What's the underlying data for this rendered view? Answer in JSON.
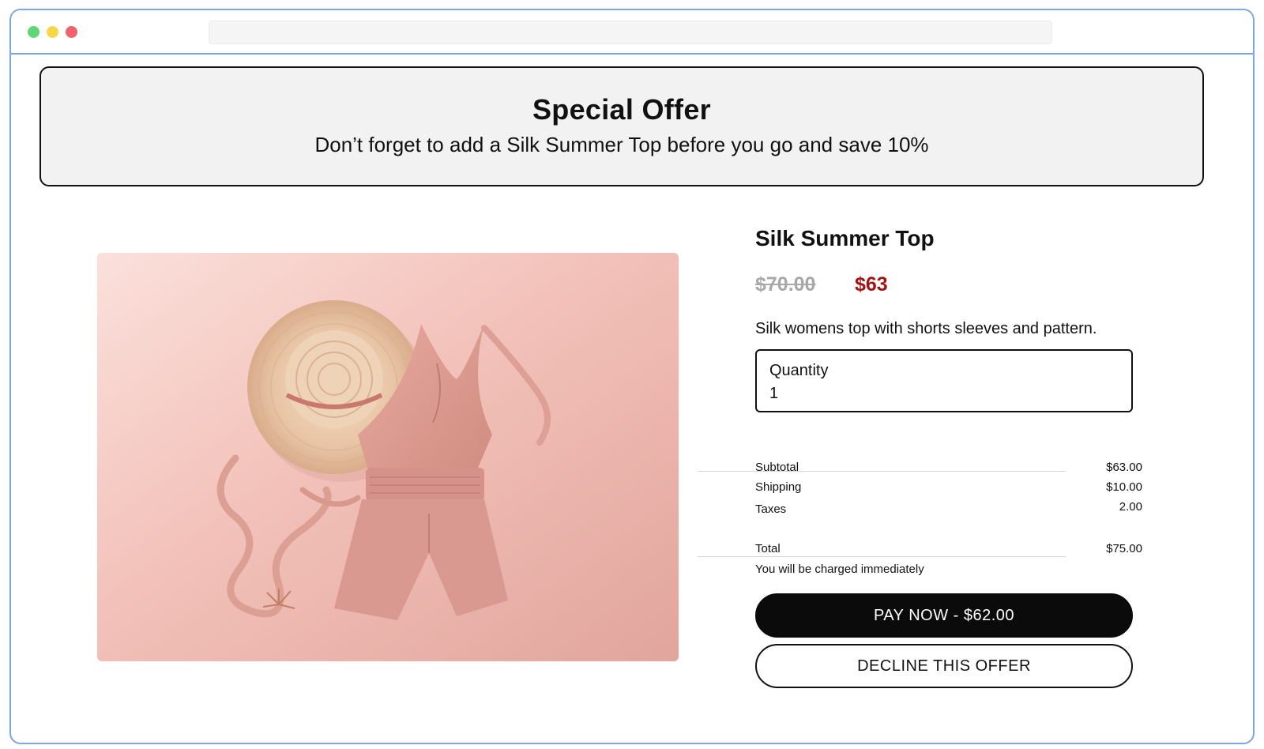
{
  "browser": {
    "address": ""
  },
  "offer": {
    "title": "Special Offer",
    "text": "Don’t forget to add a Silk Summer Top before you go and save 10%"
  },
  "product": {
    "title": "Silk Summer Top",
    "original_price": "$70.00",
    "sale_price": "$63",
    "description": "Silk womens top with shorts sleeves and pattern.",
    "image_subject": "flat-lay pink romper outfit with straw hat"
  },
  "quantity": {
    "label": "Quantity",
    "value": "1"
  },
  "summary": {
    "subtotal_label": "Subtotal",
    "subtotal_value": "$63.00",
    "shipping_label": "Shipping",
    "shipping_value": "$10.00",
    "taxes_label": "Taxes",
    "taxes_value": "2.00",
    "total_label": "Total",
    "total_value": "$75.00",
    "charge_note": "You will be charged immediately"
  },
  "buttons": {
    "pay": "PAY NOW - $62.00",
    "decline": "DECLINE THIS OFFER"
  },
  "colors": {
    "sale_price": "#a31313",
    "primary_button": "#0b0b0b",
    "banner_bg": "#f2f2f2",
    "image_bg": "#eab3aa"
  }
}
